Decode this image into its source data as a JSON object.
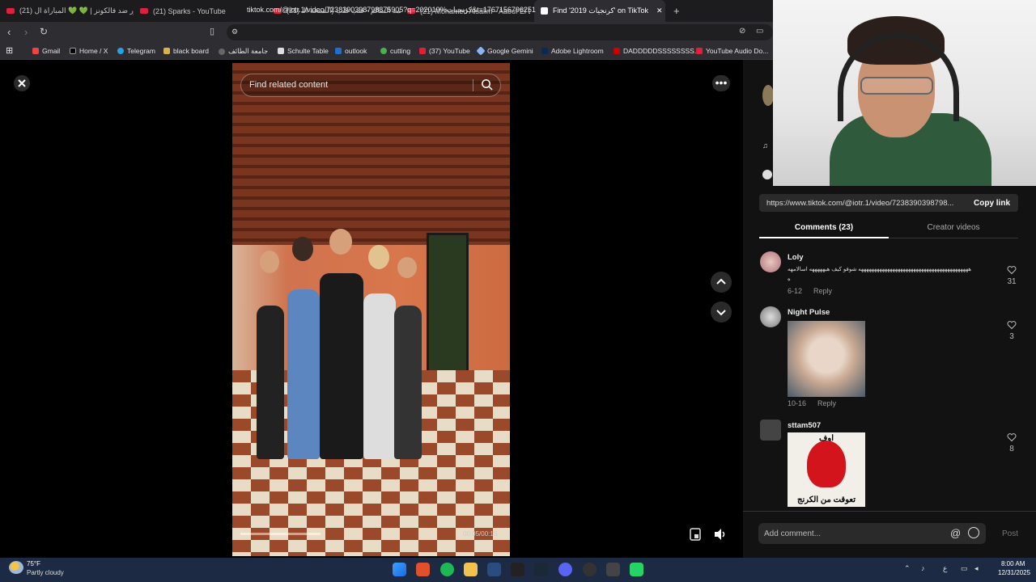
{
  "browser": {
    "tabs": [
      {
        "label": "(21) باور ضد فالكونز | 💚 💚 المباراة ال"
      },
      {
        "label": "(21) Sparks - YouTube"
      },
      {
        "label": "(21) محمد السالم - قلب قلب (النسخة الـ"
      },
      {
        "label": "(21) Mohamed Alsalim - Aaouf El Dei"
      },
      {
        "label": "Find '2019 كرنجيات' on TikTok"
      }
    ],
    "new_tab": "+",
    "url": "tiktok.com/@iotr.1/video/7238390398798875905?q=202019%كرنجيات&t=1767156796251",
    "bookmarks": [
      "Gmail",
      "Home / X",
      "Telegram",
      "black board",
      "جامعة الطائف",
      "Schulte Table",
      "outlook",
      "cutting",
      "(37) YouTube",
      "Google Gemini",
      "Adobe Lightroom",
      "DADDDDDSSSSSSSS...",
      "YouTube Audio Do..."
    ]
  },
  "video": {
    "search_placeholder": "Find related content",
    "time": "00:05/00:15",
    "progress": 0.3
  },
  "panel": {
    "link": "https://www.tiktok.com/@iotr.1/video/7238390398798...",
    "copy_link": "Copy link",
    "tab_comments": "Comments (23)",
    "tab_creator": "Creator videos",
    "comments": [
      {
        "user": "Loly",
        "text": "ههههههههههههههههههههههههههههههههههههههههههه شوفو كيف هيهههههه اسالامهه",
        "text2": "ه",
        "date": "6-12",
        "reply": "Reply",
        "likes": "31"
      },
      {
        "user": "Night Pulse",
        "date": "10-16",
        "reply": "Reply",
        "likes": "3"
      },
      {
        "user": "sttam507",
        "img_top": "اوف",
        "img_caption": "تعوقت من الكرنج",
        "likes": "8"
      }
    ],
    "add_comment": "Add comment...",
    "at": "@",
    "post": "Post"
  },
  "taskbar": {
    "temp": "75°F",
    "weather": "Partly cloudy",
    "time": "8:00 AM",
    "date": "12/31/2025",
    "lang": "ع"
  }
}
